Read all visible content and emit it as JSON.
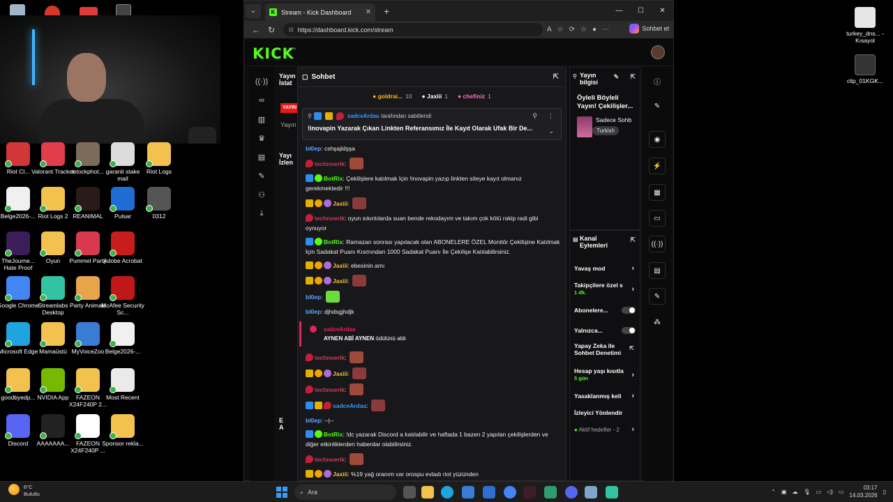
{
  "browser": {
    "tab_title": "Stream - Kick Dashboard",
    "url": "https://dashboard.kick.com/stream",
    "copilot_label": "Sohbet et",
    "logo": "KICK",
    "beta": "BETA"
  },
  "left_panel": {
    "title_line1": "Yayın",
    "title_line2": "İstat",
    "live_badge": "YAYIN",
    "sub": "Yayın",
    "title2_line1": "Yayı",
    "title2_line2": "İzlen",
    "title3_line1": "E",
    "title3_line2": "A"
  },
  "chat": {
    "header": "Sohbet",
    "gifters": [
      {
        "name": "goldrai...",
        "count": "10"
      },
      {
        "name": "Jaxiii",
        "count": "1"
      },
      {
        "name": "chefiniz",
        "count": "1"
      }
    ],
    "pinned": {
      "by": "sadceArdaa",
      "suffix": "tarafından sabitlendi",
      "message": "!inovapin Yazarak Çıkan Linkten Referansımız İle Kayıt Olarak Ufak Bir De..."
    },
    "messages": [
      {
        "user": "bl0ep",
        "text": "cshşajldşşa",
        "color": "#5ba7ff"
      },
      {
        "user": "technoerik",
        "text": "",
        "color": "#d33a56"
      },
      {
        "user": "BotRix",
        "text": "Çekilişlere katılmak İçin !inovapin yazıp linkten siteye kayıt olmanız gerekmektedir !!!",
        "color": "#53fc18"
      },
      {
        "user": "Jaxiii",
        "text": "",
        "color": "#f2c230"
      },
      {
        "user": "technoerik",
        "text": "oyun sıkıntılarda suan bende rekodayım ve takım çok kötü rakip radi gibi oynuyor",
        "color": "#d33a56"
      },
      {
        "user": "BotRix",
        "text": "Ramazan sonrası yapılacak olan ABONELERE ÖZEL Monitör Çekilişine Katılmak İçin Sadakat Puanı Kısmından 1000 Sadakat Puanı İle Çekilişe Katılabilirsiniz.",
        "color": "#53fc18"
      },
      {
        "user": "Jaxiii",
        "text": "ebesinin amı",
        "color": "#f2c230"
      },
      {
        "user": "Jaxiii",
        "text": "",
        "color": "#f2c230"
      },
      {
        "user": "bl0ep",
        "text": "",
        "color": "#5ba7ff"
      },
      {
        "user": "bl0ep",
        "text": "djhdsgjhdjk",
        "color": "#5ba7ff"
      }
    ],
    "reward": {
      "user": "sadceArdaa",
      "title": "AYNEN ABİ AYNEN",
      "suffix": "ödülünü aldı"
    },
    "messages2": [
      {
        "user": "technoerik",
        "text": "",
        "color": "#d33a56"
      },
      {
        "user": "Jaxiii",
        "text": "",
        "color": "#f2c230"
      },
      {
        "user": "technoerik",
        "text": "",
        "color": "#d33a56"
      },
      {
        "user": "sadceArdaa",
        "text": "",
        "color": "#3498ff"
      },
      {
        "user": "bl0ep",
        "text": "--|--",
        "color": "#5ba7ff"
      },
      {
        "user": "BotRix",
        "text": "!dc yazarak Discord a katılabilir ve haftada 1 bazen 2 yapılan çekilişlerden ve diğer etkinliklerden haberdar olabilirsiniz.",
        "color": "#53fc18"
      },
      {
        "user": "technoerik",
        "text": "",
        "color": "#d33a56"
      },
      {
        "user": "Jaxiii",
        "text": "%19 yağ oranım var orospu evladı riot yüzünden",
        "color": "#f2c230"
      },
      {
        "user": "Jaxiii",
        "text": "",
        "color": "#f2c230"
      }
    ]
  },
  "stream_info": {
    "header_line1": "Yayın",
    "header_line2": "bilgisi",
    "title": "Öyleli Böyleli Yayın! Çekilişler...",
    "category": "Sadece Sohb",
    "language": "Turkish"
  },
  "channel_actions": {
    "header_line1": "Kanal",
    "header_line2": "Eylemleri",
    "slow_mode": "Yavaş mod",
    "followers_only": "Takipçilere özel s",
    "followers_only_value": "1 dk.",
    "subscribers": "Abonelere...",
    "emote_only": "Yalnızca...",
    "ai_moderation": "Yapay Zeka ile Sohbet Denetimi",
    "account_age": "Hesap yaşı kısıtla",
    "account_age_value": "5 gün",
    "banned_words": "Yasaklanmış keli",
    "viewer_redirect": "İzleyici Yönlendir",
    "active_goals": "Aktif hedefler - 2"
  },
  "desktop_icons": [
    {
      "label": "Riot Cl...",
      "color": "#d13639"
    },
    {
      "label": "Valorant Tracker",
      "color": "#e23d4a"
    },
    {
      "label": "istockphot...",
      "color": "#7a6b5a"
    },
    {
      "label": "garanti stake mail",
      "color": "#dcdcdc"
    },
    {
      "label": "Riot Logs",
      "color": "#f2c14e"
    },
    {
      "label": "Belge2026-...",
      "color": "#f0f0f0"
    },
    {
      "label": "Riot Logs 2",
      "color": "#f2c14e"
    },
    {
      "label": "REANIMAL",
      "color": "#2a1a1a"
    },
    {
      "label": "Pulsar",
      "color": "#1e6dd5"
    },
    {
      "label": "0312",
      "color": "#555555"
    },
    {
      "label": "TheJourne... Hate Proof",
      "color": "#3b1d5a"
    },
    {
      "label": "Oyun",
      "color": "#f2c14e"
    },
    {
      "label": "Pummel Party",
      "color": "#d8394f"
    },
    {
      "label": "Adobe Acrobat",
      "color": "#c81d1d"
    },
    {
      "label": "",
      "color": "#000000"
    },
    {
      "label": "Google Chrome",
      "color": "#4285f4"
    },
    {
      "label": "Streamlabs Desktop",
      "color": "#31c3a2"
    },
    {
      "label": "Party Animals",
      "color": "#e8a44a"
    },
    {
      "label": "McAfee Security Sc...",
      "color": "#c01818"
    },
    {
      "label": "",
      "color": "#000000"
    },
    {
      "label": "Microsoft Edge",
      "color": "#1ea5e0"
    },
    {
      "label": "Mamaüstü",
      "color": "#f2c14e"
    },
    {
      "label": "MyVoiceZoo",
      "color": "#3a7bd5"
    },
    {
      "label": "Belge2026-...",
      "color": "#f0f0f0"
    },
    {
      "label": "",
      "color": "#000000"
    },
    {
      "label": "goodbyedp...",
      "color": "#f2c14e"
    },
    {
      "label": "NVIDIA App",
      "color": "#76b900"
    },
    {
      "label": "FAZEON X24F240P 2...",
      "color": "#f2c14e"
    },
    {
      "label": "Most Recent",
      "color": "#eaeaea"
    },
    {
      "label": "",
      "color": "#000000"
    },
    {
      "label": "Discord",
      "color": "#5865f2"
    },
    {
      "label": "AAAAAAA...",
      "color": "#222222"
    },
    {
      "label": "FAZEON X24F240P ...",
      "color": "#ffffff"
    },
    {
      "label": "Sponsor rekla...",
      "color": "#f2c14e"
    }
  ],
  "right_desktop_icons": [
    {
      "label": "turkey_dns... - Kısayol"
    },
    {
      "label": "clip_01KGK..."
    }
  ],
  "taskbar": {
    "temp": "6°C",
    "weather": "Bulutlu",
    "search": "Ara",
    "time": "03:17",
    "date": "14.03.2026"
  }
}
